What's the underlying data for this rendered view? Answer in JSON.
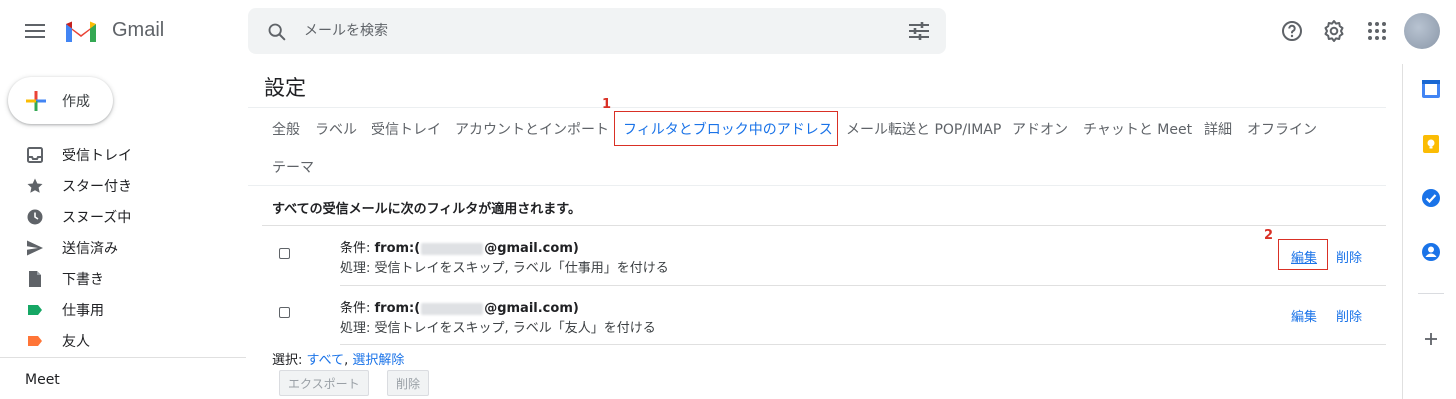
{
  "header": {
    "brand": "Gmail",
    "search_placeholder": "メールを検索"
  },
  "compose": {
    "label": "作成"
  },
  "sidebar": {
    "items": [
      {
        "label": "受信トレイ",
        "icon": "inbox-icon"
      },
      {
        "label": "スター付き",
        "icon": "star-icon"
      },
      {
        "label": "スヌーズ中",
        "icon": "clock-icon"
      },
      {
        "label": "送信済み",
        "icon": "send-icon"
      },
      {
        "label": "下書き",
        "icon": "draft-icon"
      },
      {
        "label": "仕事用",
        "icon": "label-icon",
        "color": "#16a765"
      },
      {
        "label": "友人",
        "icon": "label-icon",
        "color": "#ff7537"
      }
    ],
    "meet": "Meet"
  },
  "settings": {
    "title": "設定",
    "tabs": [
      "全般",
      "ラベル",
      "受信トレイ",
      "アカウントとインポート",
      "フィルタとブロック中のアドレス",
      "メール転送と POP/IMAP",
      "アドオン",
      "チャットと Meet",
      "詳細",
      "オフライン",
      "テーマ"
    ],
    "active_tab": "フィルタとブロック中のアドレス",
    "filter_heading": "すべての受信メールに次のフィルタが適用されます。",
    "filters": [
      {
        "cond_prefix": "条件: ",
        "cond_from": "from:(",
        "cond_suffix": "@gmail.com)",
        "action": "処理: 受信トレイをスキップ, ラベル「仕事用」を付ける",
        "edit": "編集",
        "delete": "削除"
      },
      {
        "cond_prefix": "条件: ",
        "cond_from": "from:(",
        "cond_suffix": "@gmail.com)",
        "action": "処理: 受信トレイをスキップ, ラベル「友人」を付ける",
        "edit": "編集",
        "delete": "削除"
      }
    ],
    "select_prefix": "選択: ",
    "select_all": "すべて",
    "select_sep": ", ",
    "select_none": "選択解除",
    "export_btn": "エクスポート",
    "delete_btn": "削除"
  },
  "annotations": {
    "one": "1",
    "two": "2"
  },
  "colors": {
    "accent": "#1a73e8",
    "annotation": "#d93025"
  }
}
